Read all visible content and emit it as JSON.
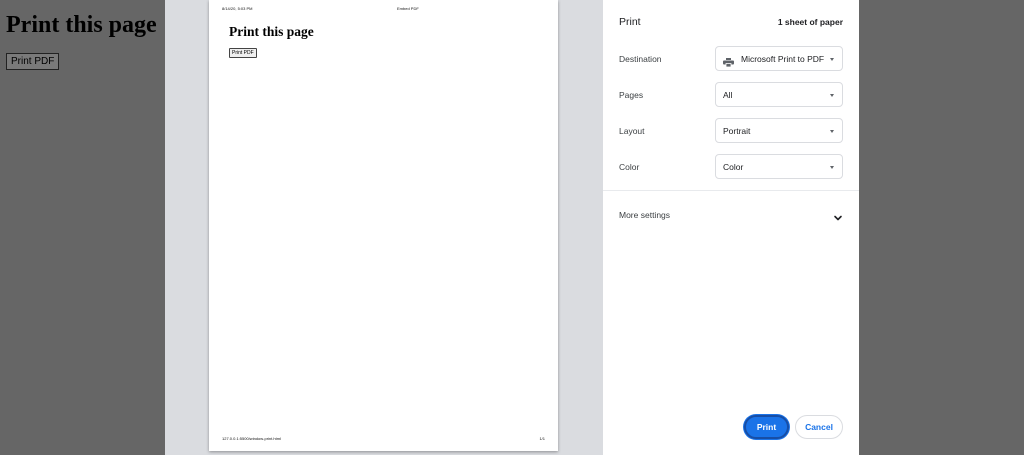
{
  "background_page": {
    "title": "Print this page",
    "button_label": "Print PDF"
  },
  "preview": {
    "header_left": "8/14/20, 5:03 PM",
    "header_center": "Embed PDF",
    "title": "Print this page",
    "button_label": "Print PDF",
    "footer_left": "127.0.0.1:5500/window-print.html",
    "footer_right": "1/1"
  },
  "sidebar": {
    "title": "Print",
    "sheet_count": "1 sheet of paper",
    "destination": {
      "label": "Destination",
      "value": "Microsoft Print to PDF",
      "icon": "printer-icon"
    },
    "pages": {
      "label": "Pages",
      "value": "All"
    },
    "layout": {
      "label": "Layout",
      "value": "Portrait"
    },
    "color": {
      "label": "Color",
      "value": "Color"
    },
    "more_settings": {
      "label": "More settings",
      "icon": "chevron-down-icon"
    },
    "print_button": "Print",
    "cancel_button": "Cancel"
  },
  "colors": {
    "accent": "#1a73e8",
    "overlay": "#666666",
    "preview_bg": "#dadce0"
  }
}
